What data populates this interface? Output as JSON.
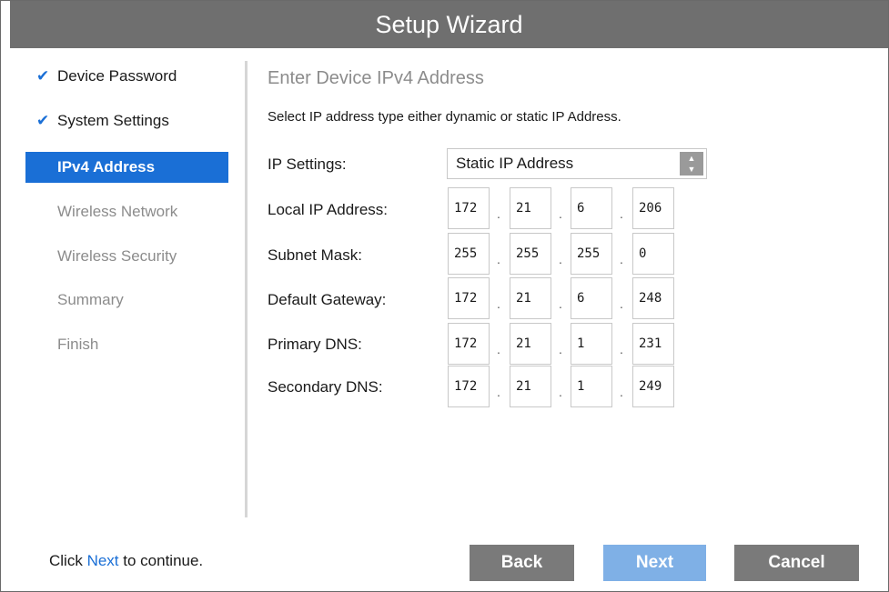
{
  "window": {
    "title": "Setup Wizard"
  },
  "steps": [
    {
      "label": "Device Password",
      "status": "done"
    },
    {
      "label": "System Settings",
      "status": "done"
    },
    {
      "label": "IPv4 Address",
      "status": "active"
    },
    {
      "label": "Wireless Network",
      "status": "inactive"
    },
    {
      "label": "Wireless Security",
      "status": "inactive"
    },
    {
      "label": "Summary",
      "status": "inactive"
    },
    {
      "label": "Finish",
      "status": "inactive"
    }
  ],
  "content": {
    "title": "Enter Device IPv4 Address",
    "subtitle": "Select IP address type either dynamic or static IP Address.",
    "ip_settings": {
      "label": "IP Settings:",
      "value": "Static IP Address"
    },
    "fields": [
      {
        "label": "Local IP Address:",
        "octets": [
          "172",
          "21",
          "6",
          "206"
        ]
      },
      {
        "label": "Subnet Mask:",
        "octets": [
          "255",
          "255",
          "255",
          "0"
        ]
      },
      {
        "label": "Default Gateway:",
        "octets": [
          "172",
          "21",
          "6",
          "248"
        ]
      },
      {
        "label": "Primary DNS:",
        "octets": [
          "172",
          "21",
          "1",
          "231"
        ]
      },
      {
        "label": "Secondary DNS:",
        "octets": [
          "172",
          "21",
          "1",
          "249"
        ]
      }
    ]
  },
  "footer": {
    "hint_prefix": "Click ",
    "hint_link": "Next",
    "hint_suffix": " to continue.",
    "back_label": "Back",
    "next_label": "Next",
    "cancel_label": "Cancel"
  },
  "colors": {
    "accent": "#1a6fd6",
    "titlebar": "#6f6f6f",
    "button_gray": "#7a7a7a",
    "button_next": "#7fb0e6"
  },
  "icons": {
    "check": "check-icon",
    "select_arrows": "updown-arrows-icon"
  }
}
